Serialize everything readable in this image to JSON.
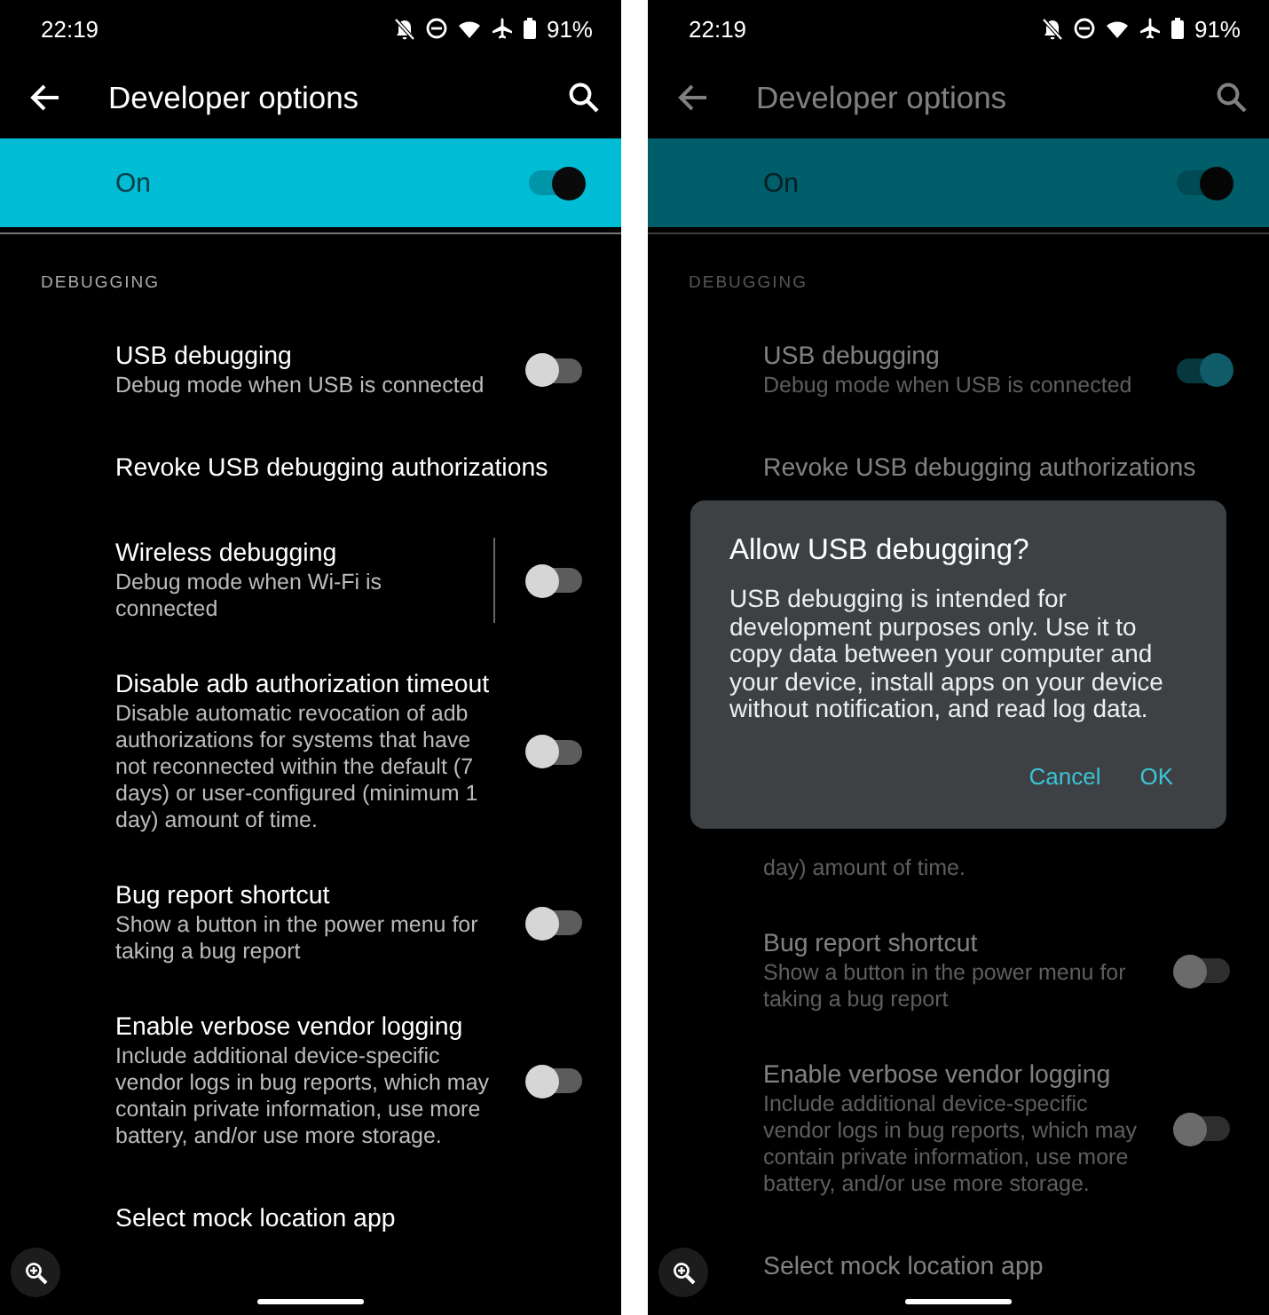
{
  "screens": [
    {
      "status_bar": {
        "time": "22:19",
        "battery": "91%"
      },
      "title": "Developer options",
      "master": {
        "label": "On",
        "on": true
      },
      "section": "DEBUGGING",
      "items": [
        {
          "kind": "switch",
          "title": "USB debugging",
          "description": "Debug mode when USB is connected",
          "on": false
        },
        {
          "kind": "action",
          "title": "Revoke USB debugging authorizations"
        },
        {
          "kind": "split_switch",
          "title": "Wireless debugging",
          "description": "Debug mode when Wi-Fi is connected",
          "on": false
        },
        {
          "kind": "switch",
          "title": "Disable adb authorization timeout",
          "description": "Disable automatic revocation of adb authorizations for systems that have not reconnected within the default (7 days) or user-configured (minimum 1 day) amount of time.",
          "on": false
        },
        {
          "kind": "switch",
          "title": "Bug report shortcut",
          "description": "Show a button in the power menu for taking a bug report",
          "on": false
        },
        {
          "kind": "switch",
          "title": "Enable verbose vendor logging",
          "description": "Include additional device-specific vendor logs in bug reports, which may contain private information, use more battery, and/or use more storage.",
          "on": false
        },
        {
          "kind": "action",
          "title": "Select mock location app"
        }
      ]
    },
    {
      "status_bar": {
        "time": "22:19",
        "battery": "91%"
      },
      "title": "Developer options",
      "master": {
        "label": "On",
        "on": true
      },
      "section": "DEBUGGING",
      "items": [
        {
          "kind": "switch",
          "title": "USB debugging",
          "description": "Debug mode when USB is connected",
          "on": true
        },
        {
          "kind": "action",
          "title": "Revoke USB debugging authorizations"
        },
        {
          "kind": "fragment",
          "description": "day) amount of time."
        },
        {
          "kind": "switch",
          "title": "Bug report shortcut",
          "description": "Show a button in the power menu for taking a bug report",
          "on": false
        },
        {
          "kind": "switch",
          "title": "Enable verbose vendor logging",
          "description": "Include additional device-specific vendor logs in bug reports, which may contain private information, use more battery, and/or use more storage.",
          "on": false
        },
        {
          "kind": "action",
          "title": "Select mock location app"
        }
      ],
      "dialog": {
        "title": "Allow USB debugging?",
        "message": "USB debugging is intended for development purposes only. Use it to copy data between your computer and your device, install apps on your device without notification, and read log data.",
        "buttons": [
          "Cancel",
          "OK"
        ]
      }
    }
  ]
}
